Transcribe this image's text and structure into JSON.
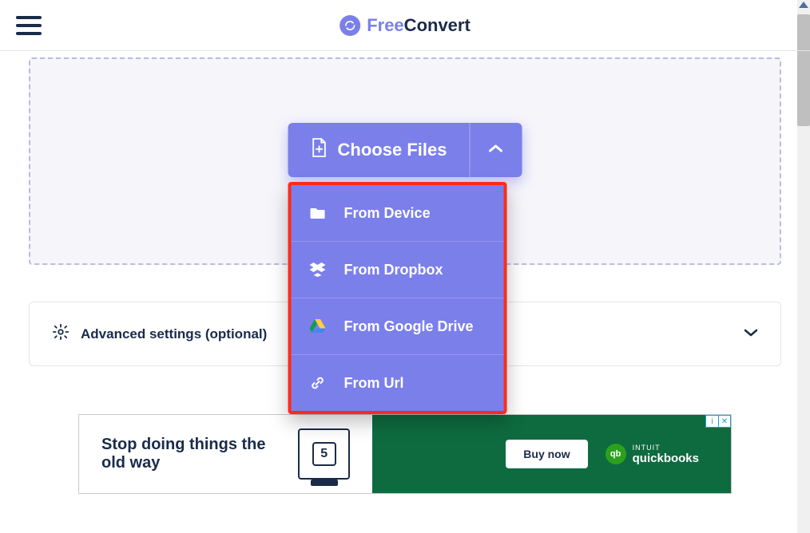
{
  "header": {
    "logo_free": "Free",
    "logo_convert": "Convert"
  },
  "upload": {
    "choose_label": "Choose Files",
    "options": [
      {
        "label": "From Device",
        "icon": "folder"
      },
      {
        "label": "From Dropbox",
        "icon": "dropbox"
      },
      {
        "label": "From Google Drive",
        "icon": "gdrive"
      },
      {
        "label": "From Url",
        "icon": "link"
      }
    ]
  },
  "advanced": {
    "label": "Advanced settings (optional)"
  },
  "ad": {
    "headline": "Stop doing things the old way",
    "monitor_number": "5",
    "cta": "Buy now",
    "brand_top": "INTUIT",
    "brand_name": "quickbooks",
    "brand_ab": "qb",
    "badge_info": "i",
    "badge_close": "✕"
  }
}
